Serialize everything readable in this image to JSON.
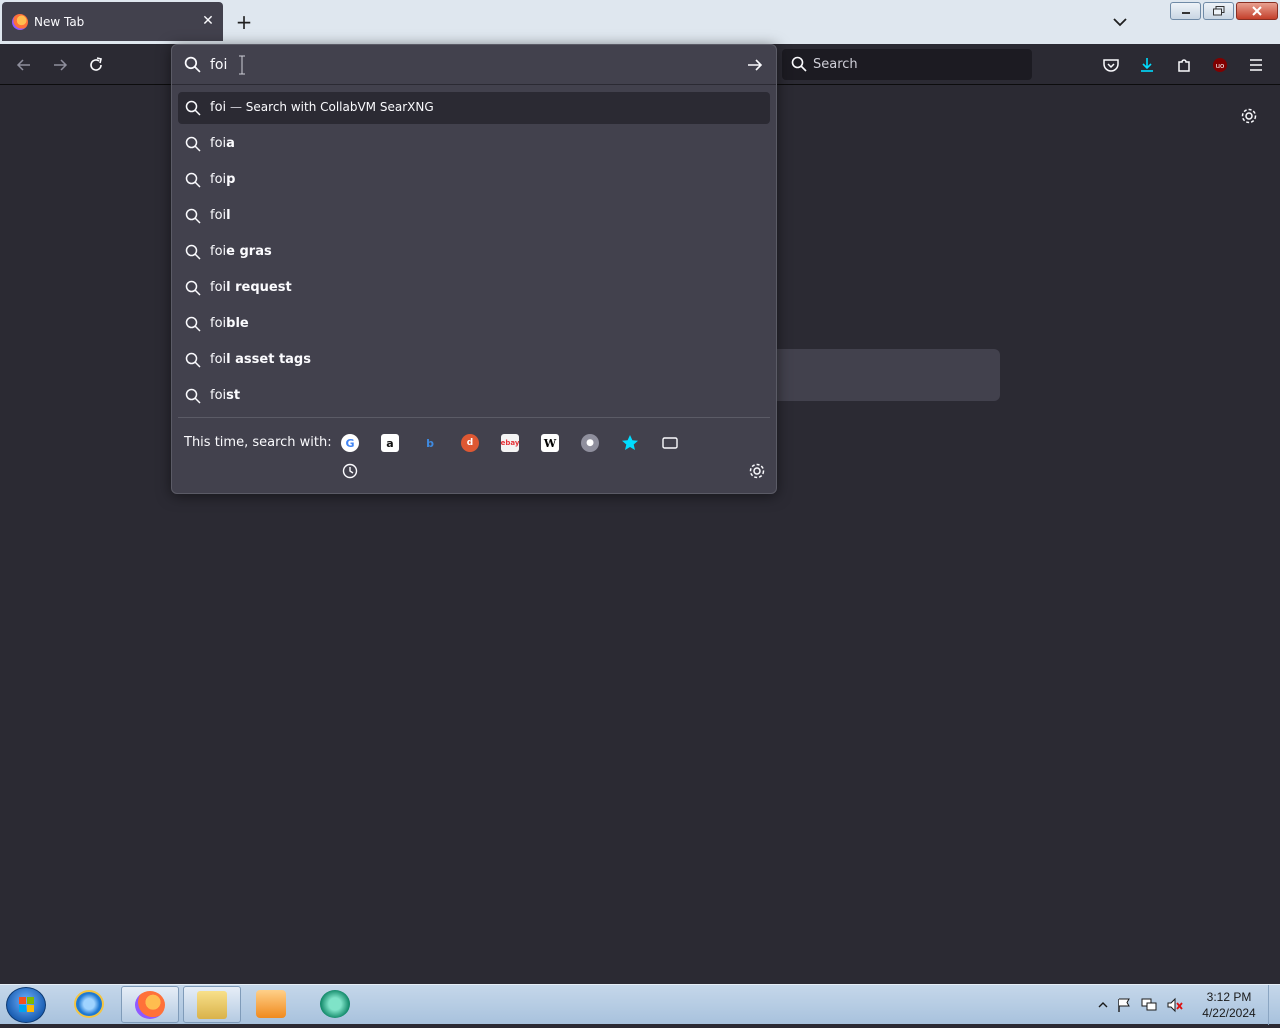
{
  "tab": {
    "title": "New Tab",
    "close_glyph": "✕"
  },
  "newtab_glyph": "+",
  "toolbar": {
    "search_placeholder": "Search"
  },
  "urlbar": {
    "value": "foi"
  },
  "suggestions": [
    {
      "typed": "foi",
      "completion": "",
      "sep": " — ",
      "action": "Search with CollabVM SearXNG",
      "selected": true
    },
    {
      "typed": "foi",
      "completion": "a"
    },
    {
      "typed": "foi",
      "completion": "p"
    },
    {
      "typed": "foi",
      "completion": "l"
    },
    {
      "typed": "foi",
      "completion": "e gras"
    },
    {
      "typed": "foi",
      "completion": "l request"
    },
    {
      "typed": "foi",
      "completion": "ble"
    },
    {
      "typed": "foi",
      "completion": "l asset tags"
    },
    {
      "typed": "foi",
      "completion": "st"
    }
  ],
  "oneoff": {
    "label": "This time, search with:",
    "engines": [
      "google-icon",
      "amazon-icon",
      "bing-icon",
      "duckduckgo-icon",
      "ebay-icon",
      "wikipedia-icon",
      "searx-icon",
      "bookmarks-icon",
      "tabs-icon",
      "history-icon"
    ]
  },
  "clock": {
    "time": "3:12 PM",
    "date": "4/22/2024"
  }
}
